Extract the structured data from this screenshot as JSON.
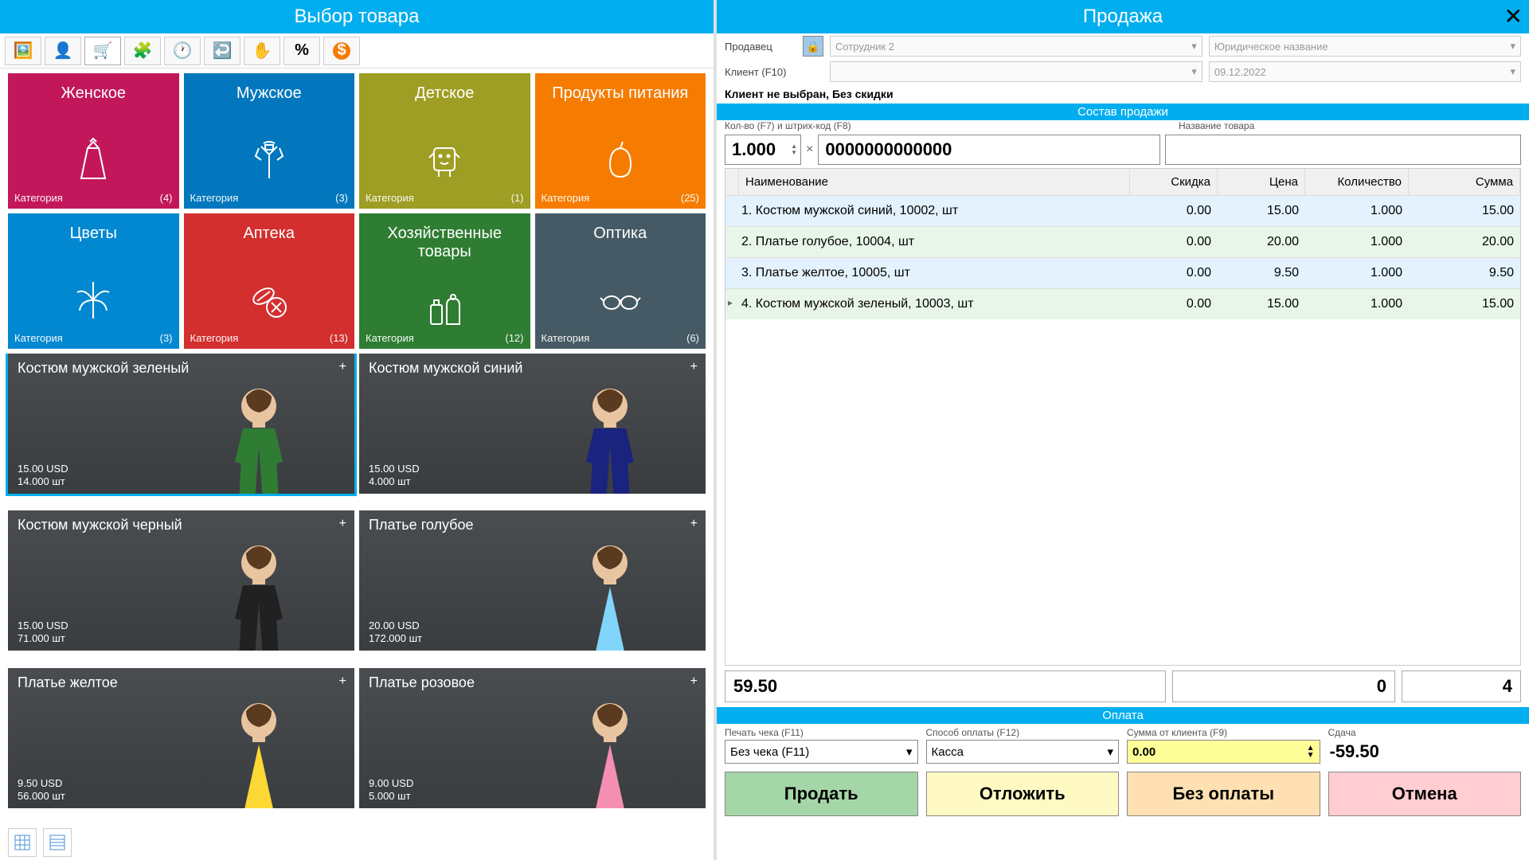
{
  "left": {
    "title": "Выбор товара",
    "categories": [
      {
        "name": "Женское",
        "footer": "Категория",
        "count": "(4)",
        "color": "#C2185B"
      },
      {
        "name": "Мужское",
        "footer": "Категория",
        "count": "(3)",
        "color": "#0277BD"
      },
      {
        "name": "Детское",
        "footer": "Категория",
        "count": "(1)",
        "color": "#9E9D24"
      },
      {
        "name": "Продукты питания",
        "footer": "Категория",
        "count": "(25)",
        "color": "#F57C00"
      },
      {
        "name": "Цветы",
        "footer": "Категория",
        "count": "(3)",
        "color": "#0288D1"
      },
      {
        "name": "Аптека",
        "footer": "Категория",
        "count": "(13)",
        "color": "#D32F2F"
      },
      {
        "name": "Хозяйственные товары",
        "footer": "Категория",
        "count": "(12)",
        "color": "#2E7D32"
      },
      {
        "name": "Оптика",
        "footer": "Категория",
        "count": "(6)",
        "color": "#455A64"
      }
    ],
    "products": [
      {
        "name": "Костюм мужской зеленый",
        "price": "15.00 USD",
        "qty": "14.000 шт",
        "color": "#2E7D32",
        "selected": true
      },
      {
        "name": "Костюм мужской синий",
        "price": "15.00 USD",
        "qty": "4.000 шт",
        "color": "#1A237E"
      },
      {
        "name": "Костюм мужской черный",
        "price": "15.00 USD",
        "qty": "71.000 шт",
        "color": "#212121"
      },
      {
        "name": "Платье голубое",
        "price": "20.00 USD",
        "qty": "172.000 шт",
        "color": "#81D4FA"
      },
      {
        "name": "Платье желтое",
        "price": "9.50 USD",
        "qty": "56.000 шт",
        "color": "#FDD835"
      },
      {
        "name": "Платье розовое",
        "price": "9.00 USD",
        "qty": "5.000 шт",
        "color": "#F48FB1"
      }
    ]
  },
  "right": {
    "title": "Продажа",
    "seller_label": "Продавец",
    "seller_value": "Сотрудник 2",
    "company_value": "Юридическое название",
    "client_label": "Клиент (F10)",
    "date_value": "09.12.2022",
    "warning": "Клиент не выбран, Без скидки",
    "section_items": "Состав продажи",
    "qty_label": "Кол-во (F7) и штрих-код (F8)",
    "name_label": "Название товара",
    "qty_value": "1.000",
    "barcode_value": "0000000000000",
    "columns": {
      "name": "Наименование",
      "disc": "Скидка",
      "price": "Цена",
      "qty": "Количество",
      "sum": "Сумма"
    },
    "rows": [
      {
        "n": "1.",
        "name": "Костюм мужской синий, 10002, шт",
        "disc": "0.00",
        "price": "15.00",
        "qty": "1.000",
        "sum": "15.00",
        "cls": "blue"
      },
      {
        "n": "2.",
        "name": "Платье голубое, 10004, шт",
        "disc": "0.00",
        "price": "20.00",
        "qty": "1.000",
        "sum": "20.00",
        "cls": "green"
      },
      {
        "n": "3.",
        "name": "Платье желтое, 10005, шт",
        "disc": "0.00",
        "price": "9.50",
        "qty": "1.000",
        "sum": "9.50",
        "cls": "blue"
      },
      {
        "n": "4.",
        "name": "Костюм мужской зеленый, 10003, шт",
        "disc": "0.00",
        "price": "15.00",
        "qty": "1.000",
        "sum": "15.00",
        "cls": "green",
        "marker": "▸"
      }
    ],
    "total_sum": "59.50",
    "total_disc": "0",
    "total_count": "4",
    "section_pay": "Оплата",
    "receipt_label": "Печать чека (F11)",
    "receipt_value": "Без чека (F11)",
    "method_label": "Способ оплаты (F12)",
    "method_value": "Касса",
    "client_amount_label": "Сумма от клиента (F9)",
    "client_amount_value": "0.00",
    "change_label": "Сдача",
    "change_value": "-59.50",
    "btn_sell": "Продать",
    "btn_hold": "Отложить",
    "btn_nopay": "Без оплаты",
    "btn_cancel": "Отмена"
  }
}
